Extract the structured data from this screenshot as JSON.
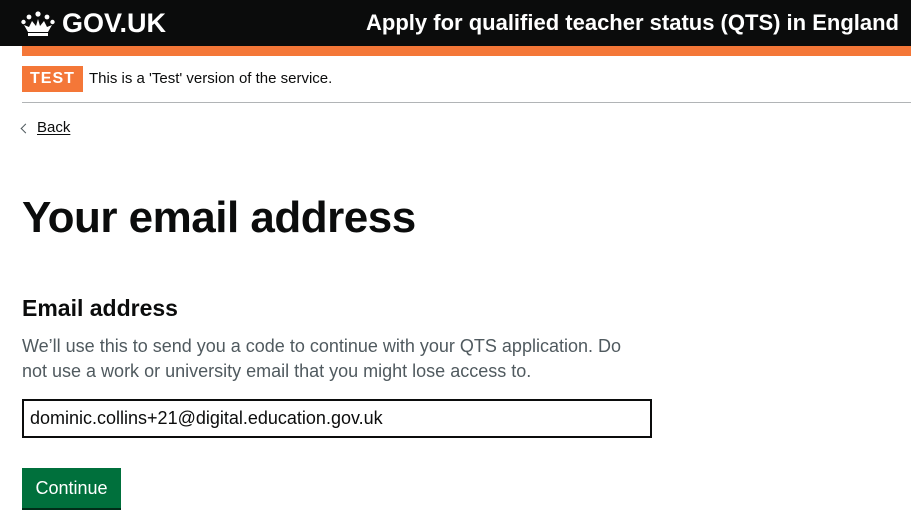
{
  "header": {
    "logo_text": "GOV.UK",
    "service_name": "Apply for qualified teacher status (QTS) in England"
  },
  "phase_banner": {
    "tag": "TEST",
    "text": "This is a 'Test' version of the service."
  },
  "back_link": {
    "label": "Back"
  },
  "page": {
    "title": "Your email address"
  },
  "form": {
    "email_label": "Email address",
    "email_hint": "We’ll use this to send you a code to continue with your QTS application. Do not use a work or university email that you might lose access to.",
    "email_value": "dominic.collins+21@digital.education.gov.uk",
    "continue_label": "Continue"
  },
  "colors": {
    "header_bg": "#0b0c0c",
    "accent_orange": "#f47738",
    "button_green": "#00703c",
    "hint_grey": "#505a5f"
  },
  "icons": {
    "logo_icon": "crown-icon",
    "back_icon": "chevron-left-icon"
  }
}
